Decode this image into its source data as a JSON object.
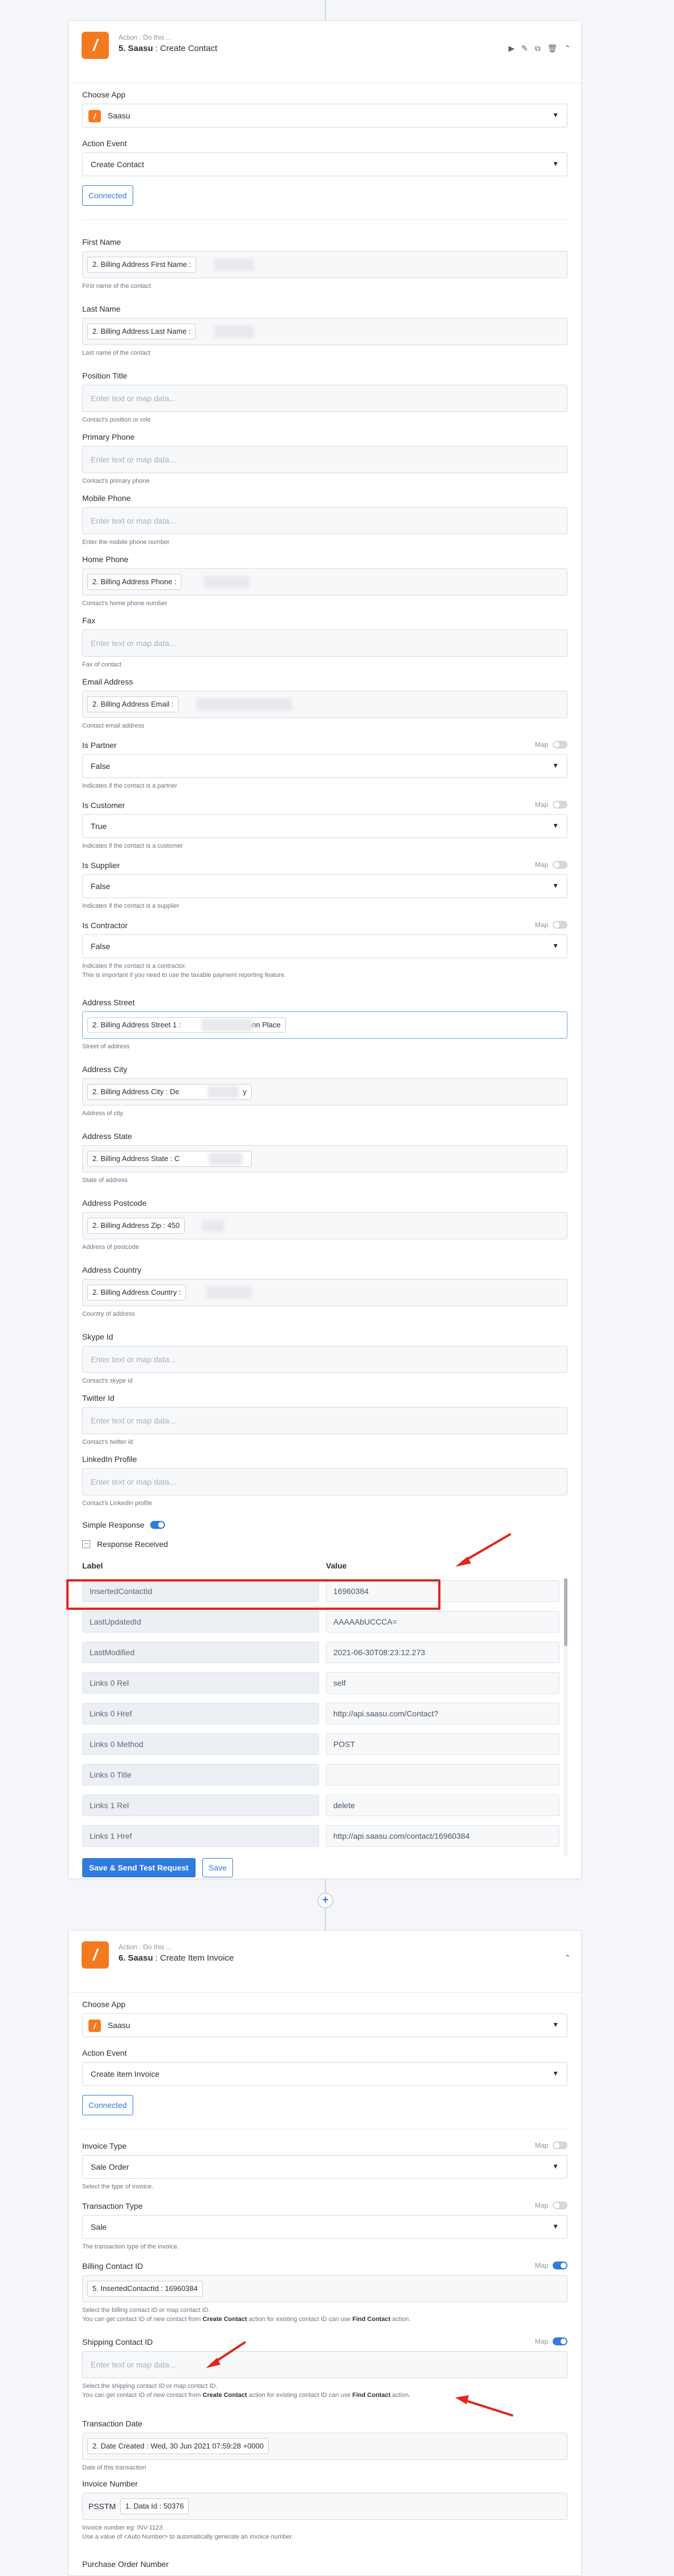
{
  "card1": {
    "sub": "Action : Do this ...",
    "step": "5. Saasu",
    "title_rest": ": Create Contact",
    "choose_app_label": "Choose App",
    "app_name": "Saasu",
    "action_event_label": "Action Event",
    "action_event_value": "Create Contact",
    "connected_label": "Connected",
    "map_label": "Map",
    "placeholder": "Enter text or map data...",
    "fields": {
      "first_name": {
        "label": "First Name",
        "token": "2. Billing Address First Name :",
        "help": "First name of the contact"
      },
      "last_name": {
        "label": "Last Name",
        "token": "2. Billing Address Last Name :",
        "help": "Last name of the contact"
      },
      "position_title": {
        "label": "Position Title",
        "help": "Contact's position or role"
      },
      "primary_phone": {
        "label": "Primary Phone",
        "help": "Contact's primary phone"
      },
      "mobile_phone": {
        "label": "Mobile Phone",
        "help": "Enter the mobile phone number"
      },
      "home_phone": {
        "label": "Home Phone",
        "token": "2. Billing Address Phone :",
        "help": "Contact's home phone number"
      },
      "fax": {
        "label": "Fax",
        "help": "Fax of contact"
      },
      "email": {
        "label": "Email Address",
        "token": "2. Billing Address Email :",
        "help": "Contact email address"
      },
      "is_partner": {
        "label": "Is Partner",
        "value": "False",
        "help": "Indicates if the contact is a partner"
      },
      "is_customer": {
        "label": "Is Customer",
        "value": "True",
        "help": "Indicates if the contact is a customer"
      },
      "is_supplier": {
        "label": "Is Supplier",
        "value": "False",
        "help": "Indicates if the contact is a supplier"
      },
      "is_contractor": {
        "label": "Is Contractor",
        "value": "False",
        "help": "Indicates if the contact is a contractor.",
        "help2": "This is important if you need to use the taxable payment reporting feature."
      },
      "address_street": {
        "label": "Address Street",
        "token": "2. Billing Address Street 1 :",
        "token_tail": "nnn Place",
        "help": "Street of address"
      },
      "address_city": {
        "label": "Address City",
        "token": "2. Billing Address City : De",
        "token_tail": "y",
        "help": "Address of city"
      },
      "address_state": {
        "label": "Address State",
        "token": "2. Billing Address State : C",
        "help": "State of address"
      },
      "address_postcode": {
        "label": "Address Postcode",
        "token": "2. Billing Address Zip : 450",
        "help": "Address of postcode"
      },
      "address_country": {
        "label": "Address Country",
        "token": "2. Billing Address Country :",
        "help": "Country of address"
      },
      "skype_id": {
        "label": "Skype Id",
        "help": "Contact's skype id"
      },
      "twitter_id": {
        "label": "Twitter Id",
        "help": "Contact's twitter id"
      },
      "linkedin": {
        "label": "LinkedIn Profile",
        "help": "Contact's LinkedIn profile"
      }
    },
    "simple_response_label": "Simple Response",
    "response_received_label": "Response Received",
    "col_label": "Label",
    "col_value": "Value",
    "response_rows": [
      {
        "label": "InsertedContactId",
        "value": "16960384"
      },
      {
        "label": "LastUpdatedId",
        "value": "AAAAAbUCCCA="
      },
      {
        "label": "LastModified",
        "value": "2021-06-30T08:23:12.273"
      },
      {
        "label": "Links 0 Rel",
        "value": "self"
      },
      {
        "label": "Links 0 Href",
        "value": "http://api.saasu.com/Contact?"
      },
      {
        "label": "Links 0 Method",
        "value": "POST"
      },
      {
        "label": "Links 0 Title",
        "value": ""
      },
      {
        "label": "Links 1 Rel",
        "value": "delete"
      },
      {
        "label": "Links 1 Href",
        "value": "http://api.saasu.com/contact/16960384"
      }
    ],
    "save_send_label": "Save & Send Test Request",
    "save_label": "Save"
  },
  "card2": {
    "sub": "Action : Do this ...",
    "step": "6. Saasu",
    "title_rest": ": Create Item Invoice",
    "choose_app_label": "Choose App",
    "app_name": "Saasu",
    "action_event_label": "Action Event",
    "action_event_value": "Create Item Invoice",
    "connected_label": "Connected",
    "map_label": "Map",
    "placeholder": "Enter text or map data...",
    "invoice_type": {
      "label": "Invoice Type",
      "value": "Sale Order",
      "help": "Select the type of invoice."
    },
    "transaction_type": {
      "label": "Transaction Type",
      "value": "Sale",
      "help": "The transaction type of the invoice."
    },
    "billing_contact": {
      "label": "Billing Contact ID",
      "token": "5. InsertedContactId : 16960384",
      "help": "Select the billing contact ID or map contact ID.",
      "help2_pre": "You can get contact ID of new contact from ",
      "help2_b1": "Create Contact",
      "help2_mid": " action for existing contact ID can use ",
      "help2_b2": "Find Contact",
      "help2_post": " action."
    },
    "shipping_contact": {
      "label": "Shipping Contact ID",
      "help": "Select the shipping contact ID or map contact ID.",
      "help2_pre": "You can get contact ID of new contact from ",
      "help2_b1": "Create Contact",
      "help2_mid": " action for existing contact ID can use ",
      "help2_b2": "Find Contact",
      "help2_post": " action."
    },
    "transaction_date": {
      "label": "Transaction Date",
      "token": "2. Date Created : Wed, 30 Jun 2021 07:59:28 +0000",
      "help": "Date of this transaction"
    },
    "invoice_number": {
      "label": "Invoice Number",
      "prefix": "PSSTM",
      "token": "1. Data Id : 50376",
      "help": "Invoice number eg: INV-1123",
      "help2": "Use a value of <Auto Number> to automatically generate an invoice number."
    },
    "purchase_order_label": "Purchase Order Number"
  },
  "colors": {
    "accent": "#2f7be0",
    "brand": "#f47a20",
    "highlight": "#e0261d"
  }
}
